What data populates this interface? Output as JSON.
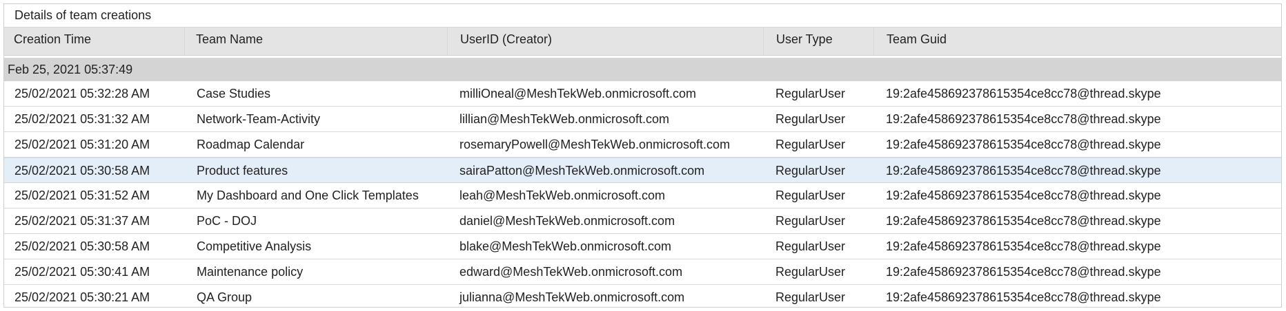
{
  "panel": {
    "caption": "Details of team creations"
  },
  "columns": [
    {
      "label": "Creation Time"
    },
    {
      "label": "Team Name"
    },
    {
      "label": "UserID (Creator)"
    },
    {
      "label": "User Type"
    },
    {
      "label": "Team Guid"
    }
  ],
  "group": {
    "label": "Feb 25, 2021 05:37:49"
  },
  "rows": [
    {
      "time": "25/02/2021 05:32:28 AM",
      "team": "Case Studies",
      "user": "milliOneal@MeshTekWeb.onmicrosoft.com",
      "type": "RegularUser",
      "guid": "19:2afe458692378615354ce8cc78@thread.skype"
    },
    {
      "time": "25/02/2021 05:31:32 AM",
      "team": "Network-Team-Activity",
      "user": "lillian@MeshTekWeb.onmicrosoft.com",
      "type": "RegularUser",
      "guid": "19:2afe458692378615354ce8cc78@thread.skype"
    },
    {
      "time": "25/02/2021 05:31:20 AM",
      "team": "Roadmap Calendar",
      "user": "rosemaryPowell@MeshTekWeb.onmicrosoft.com",
      "type": "RegularUser",
      "guid": "19:2afe458692378615354ce8cc78@thread.skype"
    },
    {
      "time": "25/02/2021 05:30:58 AM",
      "team": "Product features",
      "user": "sairaPatton@MeshTekWeb.onmicrosoft.com",
      "type": "RegularUser",
      "guid": "19:2afe458692378615354ce8cc78@thread.skype"
    },
    {
      "time": "25/02/2021 05:31:52 AM",
      "team": "My Dashboard and One Click Templates",
      "user": "leah@MeshTekWeb.onmicrosoft.com",
      "type": "RegularUser",
      "guid": "19:2afe458692378615354ce8cc78@thread.skype"
    },
    {
      "time": "25/02/2021 05:31:37 AM",
      "team": "PoC - DOJ",
      "user": "daniel@MeshTekWeb.onmicrosoft.com",
      "type": "RegularUser",
      "guid": "19:2afe458692378615354ce8cc78@thread.skype"
    },
    {
      "time": "25/02/2021 05:30:58 AM",
      "team": "Competitive Analysis",
      "user": "blake@MeshTekWeb.onmicrosoft.com",
      "type": "RegularUser",
      "guid": "19:2afe458692378615354ce8cc78@thread.skype"
    },
    {
      "time": "25/02/2021 05:30:41 AM",
      "team": "Maintenance policy",
      "user": "edward@MeshTekWeb.onmicrosoft.com",
      "type": "RegularUser",
      "guid": "19:2afe458692378615354ce8cc78@thread.skype"
    },
    {
      "time": "25/02/2021 05:30:21 AM",
      "team": "QA Group",
      "user": "julianna@MeshTekWeb.onmicrosoft.com",
      "type": "RegularUser",
      "guid": "19:2afe458692378615354ce8cc78@thread.skype"
    }
  ],
  "selected_row": 3,
  "colors": {
    "header_bg": "#e4e4e4",
    "group_bg": "#d4d4d4",
    "selected_row_bg": "#e3eef8",
    "border": "#d8d8d8"
  }
}
